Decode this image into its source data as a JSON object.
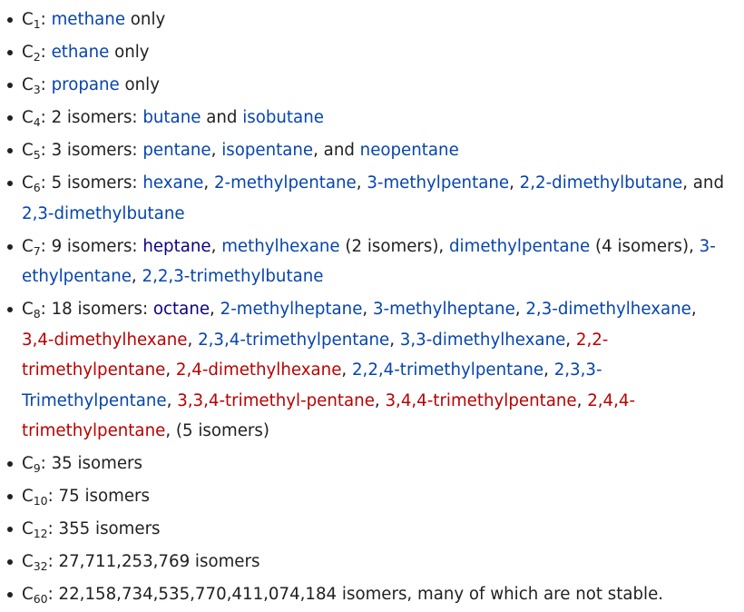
{
  "colors": {
    "text": "#202122",
    "link": "#0645ad",
    "visited": "#0b0080",
    "redlink": "#ba0000"
  },
  "items": [
    {
      "n": "1",
      "parts": [
        {
          "t": ": "
        },
        {
          "t": "methane",
          "link": "blue"
        },
        {
          "t": " only"
        }
      ]
    },
    {
      "n": "2",
      "parts": [
        {
          "t": ": "
        },
        {
          "t": "ethane",
          "link": "blue"
        },
        {
          "t": " only"
        }
      ]
    },
    {
      "n": "3",
      "parts": [
        {
          "t": ": "
        },
        {
          "t": "propane",
          "link": "blue"
        },
        {
          "t": " only"
        }
      ]
    },
    {
      "n": "4",
      "parts": [
        {
          "t": ": 2 isomers: "
        },
        {
          "t": "butane",
          "link": "blue"
        },
        {
          "t": " and "
        },
        {
          "t": "isobutane",
          "link": "blue"
        }
      ]
    },
    {
      "n": "5",
      "parts": [
        {
          "t": ": 3 isomers: "
        },
        {
          "t": "pentane",
          "link": "blue"
        },
        {
          "t": ", "
        },
        {
          "t": "isopentane",
          "link": "blue"
        },
        {
          "t": ", and "
        },
        {
          "t": "neopentane",
          "link": "blue"
        }
      ]
    },
    {
      "n": "6",
      "parts": [
        {
          "t": ": 5 isomers: "
        },
        {
          "t": "hexane",
          "link": "blue"
        },
        {
          "t": ", "
        },
        {
          "t": "2-methylpentane",
          "link": "blue"
        },
        {
          "t": ", "
        },
        {
          "t": "3-methylpentane",
          "link": "blue"
        },
        {
          "t": ", "
        },
        {
          "t": "2,2-dimethylbutane",
          "link": "blue"
        },
        {
          "t": ", and "
        },
        {
          "t": "2,3-dimethylbutane",
          "link": "blue",
          "br": true
        }
      ]
    },
    {
      "n": "7",
      "parts": [
        {
          "t": ": 9 isomers: "
        },
        {
          "t": "heptane",
          "link": "visited"
        },
        {
          "t": ", "
        },
        {
          "t": "methylhexane",
          "link": "blue"
        },
        {
          "t": " (2 isomers), "
        },
        {
          "t": "dimethylpentane",
          "link": "blue"
        },
        {
          "t": " (4 isomers), "
        },
        {
          "t": "3-",
          "link": "blue"
        },
        {
          "t": "ethylpentane",
          "link": "blue",
          "br": true
        },
        {
          "t": ", "
        },
        {
          "t": "2,2,3-trimethylbutane",
          "link": "blue"
        }
      ]
    },
    {
      "n": "8",
      "parts": [
        {
          "t": ": 18 isomers: "
        },
        {
          "t": "octane",
          "link": "visited"
        },
        {
          "t": ", "
        },
        {
          "t": "2-methylheptane",
          "link": "blue"
        },
        {
          "t": ", "
        },
        {
          "t": "3-methylheptane",
          "link": "blue"
        },
        {
          "t": ", "
        },
        {
          "t": "2,3-dimethylhexane",
          "link": "blue"
        },
        {
          "t": ","
        },
        {
          "t": "3,4-dimethylhexane",
          "link": "red",
          "br": true
        },
        {
          "t": ", "
        },
        {
          "t": "2,3,4-trimethylpentane",
          "link": "blue"
        },
        {
          "t": ", "
        },
        {
          "t": "3,3-dimethylhexane",
          "link": "blue"
        },
        {
          "t": ", "
        },
        {
          "t": "2,2-",
          "link": "red"
        },
        {
          "t": "trimethylpentane",
          "link": "red",
          "br": true
        },
        {
          "t": ", "
        },
        {
          "t": "2,4-dimethylhexane",
          "link": "red"
        },
        {
          "t": ", "
        },
        {
          "t": "2,2,4-trimethylpentane",
          "link": "blue"
        },
        {
          "t": ", "
        },
        {
          "t": "2,3,3-",
          "link": "blue"
        },
        {
          "t": "Trimethylpentane",
          "link": "blue",
          "br": true
        },
        {
          "t": ", "
        },
        {
          "t": "3,3,4-trimethyl-pentane",
          "link": "red"
        },
        {
          "t": ", "
        },
        {
          "t": "3,4,4-trimethylpentane",
          "link": "red"
        },
        {
          "t": ", "
        },
        {
          "t": "2,4,4-",
          "link": "red"
        },
        {
          "t": "trimethylpentane",
          "link": "red",
          "br": true
        },
        {
          "t": ", (5 isomers)"
        }
      ]
    },
    {
      "n": "9",
      "parts": [
        {
          "t": ": 35 isomers"
        }
      ]
    },
    {
      "n": "10",
      "parts": [
        {
          "t": ": 75 isomers"
        }
      ]
    },
    {
      "n": "12",
      "parts": [
        {
          "t": ": 355 isomers"
        }
      ]
    },
    {
      "n": "32",
      "parts": [
        {
          "t": ": 27,711,253,769 isomers"
        }
      ]
    },
    {
      "n": "60",
      "parts": [
        {
          "t": ": 22,158,734,535,770,411,074,184 isomers, many of which are not stable."
        }
      ]
    }
  ]
}
